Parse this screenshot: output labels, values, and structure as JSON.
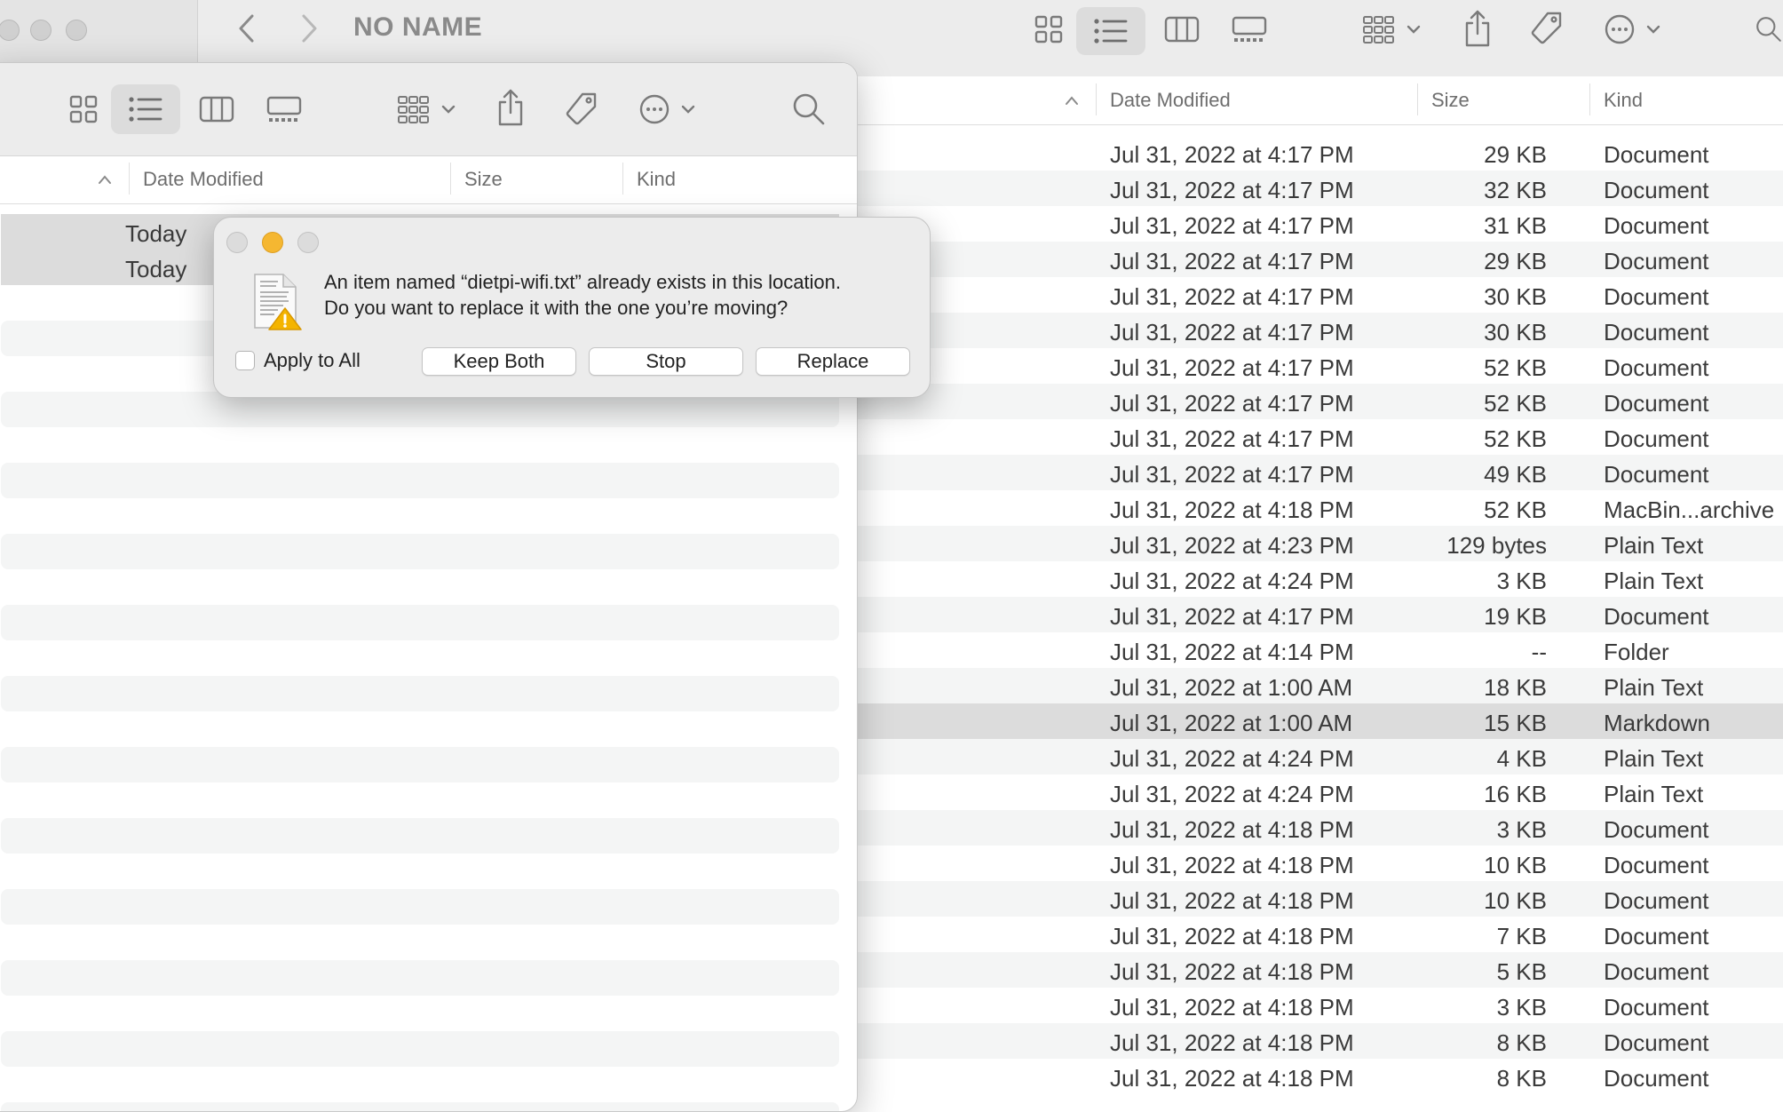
{
  "back_window": {
    "title": "NO NAME",
    "columns": {
      "sort_indicator": "^",
      "date": "Date Modified",
      "size": "Size",
      "kind": "Kind"
    },
    "rows": [
      {
        "date": "Jul 31, 2022 at 4:17 PM",
        "size": "29 KB",
        "kind": "Document"
      },
      {
        "date": "Jul 31, 2022 at 4:17 PM",
        "size": "32 KB",
        "kind": "Document"
      },
      {
        "date": "Jul 31, 2022 at 4:17 PM",
        "size": "31 KB",
        "kind": "Document"
      },
      {
        "date": "Jul 31, 2022 at 4:17 PM",
        "size": "29 KB",
        "kind": "Document"
      },
      {
        "date": "Jul 31, 2022 at 4:17 PM",
        "size": "30 KB",
        "kind": "Document"
      },
      {
        "date": "Jul 31, 2022 at 4:17 PM",
        "size": "30 KB",
        "kind": "Document"
      },
      {
        "date": "Jul 31, 2022 at 4:17 PM",
        "size": "52 KB",
        "kind": "Document"
      },
      {
        "date": "Jul 31, 2022 at 4:17 PM",
        "size": "52 KB",
        "kind": "Document"
      },
      {
        "date": "Jul 31, 2022 at 4:17 PM",
        "size": "52 KB",
        "kind": "Document"
      },
      {
        "date": "Jul 31, 2022 at 4:17 PM",
        "size": "49 KB",
        "kind": "Document"
      },
      {
        "date": "Jul 31, 2022 at 4:18 PM",
        "size": "52 KB",
        "kind": "MacBin...archive"
      },
      {
        "date": "Jul 31, 2022 at 4:23 PM",
        "size": "129 bytes",
        "kind": "Plain Text"
      },
      {
        "date": "Jul 31, 2022 at 4:24 PM",
        "size": "3 KB",
        "kind": "Plain Text"
      },
      {
        "date": "Jul 31, 2022 at 4:17 PM",
        "size": "19 KB",
        "kind": "Document"
      },
      {
        "date": "Jul 31, 2022 at 4:14 PM",
        "size": "--",
        "kind": "Folder"
      },
      {
        "date": "Jul 31, 2022 at 1:00 AM",
        "size": "18 KB",
        "kind": "Plain Text"
      },
      {
        "date": "Jul 31, 2022 at 1:00 AM",
        "size": "15 KB",
        "kind": "Markdown",
        "selected": true
      },
      {
        "date": "Jul 31, 2022 at 4:24 PM",
        "size": "4 KB",
        "kind": "Plain Text"
      },
      {
        "date": "Jul 31, 2022 at 4:24 PM",
        "size": "16 KB",
        "kind": "Plain Text"
      },
      {
        "date": "Jul 31, 2022 at 4:18 PM",
        "size": "3 KB",
        "kind": "Document"
      },
      {
        "date": "Jul 31, 2022 at 4:18 PM",
        "size": "10 KB",
        "kind": "Document"
      },
      {
        "date": "Jul 31, 2022 at 4:18 PM",
        "size": "10 KB",
        "kind": "Document"
      },
      {
        "date": "Jul 31, 2022 at 4:18 PM",
        "size": "7 KB",
        "kind": "Document"
      },
      {
        "date": "Jul 31, 2022 at 4:18 PM",
        "size": "5 KB",
        "kind": "Document"
      },
      {
        "date": "Jul 31, 2022 at 4:18 PM",
        "size": "3 KB",
        "kind": "Document"
      },
      {
        "date": "Jul 31, 2022 at 4:18 PM",
        "size": "8 KB",
        "kind": "Document"
      },
      {
        "date": "Jul 31, 2022 at 4:18 PM",
        "size": "8 KB",
        "kind": "Document"
      }
    ]
  },
  "front_window": {
    "columns": {
      "sort_indicator": "^",
      "date": "Date Modified",
      "size": "Size",
      "kind": "Kind"
    },
    "rows": [
      {
        "date": "Today",
        "selected": true
      },
      {
        "date": "Today",
        "selected": true
      }
    ]
  },
  "dialog": {
    "message_line1": "An item named “dietpi-wifi.txt” already exists in this location.",
    "message_line2": "Do you want to replace it with the one you’re moving?",
    "checkbox_label": "Apply to All",
    "checkbox_checked": false,
    "buttons": {
      "keep_both": "Keep Both",
      "stop": "Stop",
      "replace": "Replace"
    }
  },
  "icons": {
    "toolbar": [
      "icon-view-icon",
      "list-view-icon",
      "column-view-icon",
      "gallery-view-icon",
      "group-icon",
      "share-icon",
      "tag-icon",
      "more-actions-icon",
      "search-icon"
    ],
    "dialog": "document-warning-icon"
  },
  "colors": {
    "minimize_yellow": "#f5b731",
    "warning_yellow": "#f4b400",
    "selection_gray": "#dcdcdc"
  }
}
